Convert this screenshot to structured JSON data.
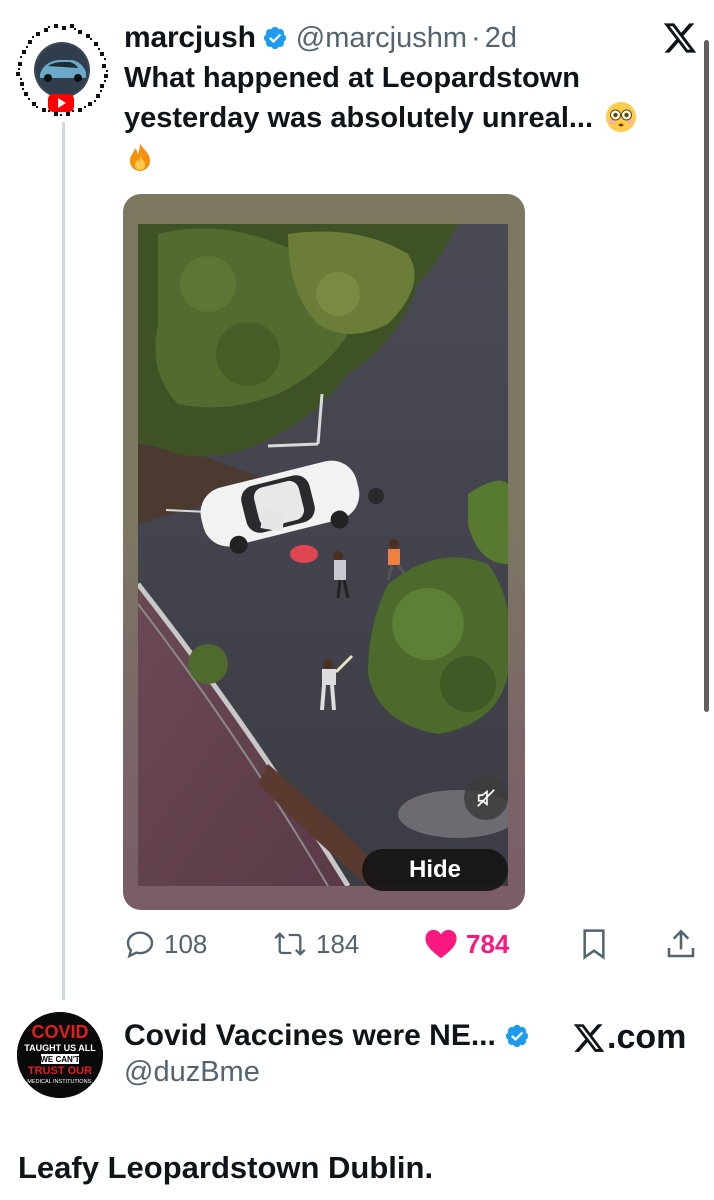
{
  "tweet": {
    "author_name": "marcjush",
    "handle": "@marcjushm",
    "separator": "·",
    "time": "2d",
    "text_line1": "What happened at Leopardstown",
    "text_line2": "yesterday was absolutely unreal...",
    "emoji1": "flushed-face-emoji",
    "emoji2": "fire-emoji",
    "media": {
      "hide_label": "Hide",
      "mute_icon": "muted-speaker-icon"
    },
    "stats": {
      "replies": "108",
      "reposts": "184",
      "likes": "784"
    }
  },
  "reply": {
    "author_name": "Covid Vaccines were NE...",
    "handle": "@duzBme",
    "avatar_text": {
      "line1": "COVID",
      "line2": "TAUGHT US ALL",
      "line3": "WE CAN'T",
      "line4": "TRUST OUR",
      "line5": "MEDICAL INSTITUTIONS."
    },
    "badge": ".com",
    "text": "Leafy Leopardstown Dublin."
  },
  "colors": {
    "text": "#0f1419",
    "secondary": "#536471",
    "verified": "#1d9bf0",
    "like": "#f91880"
  }
}
